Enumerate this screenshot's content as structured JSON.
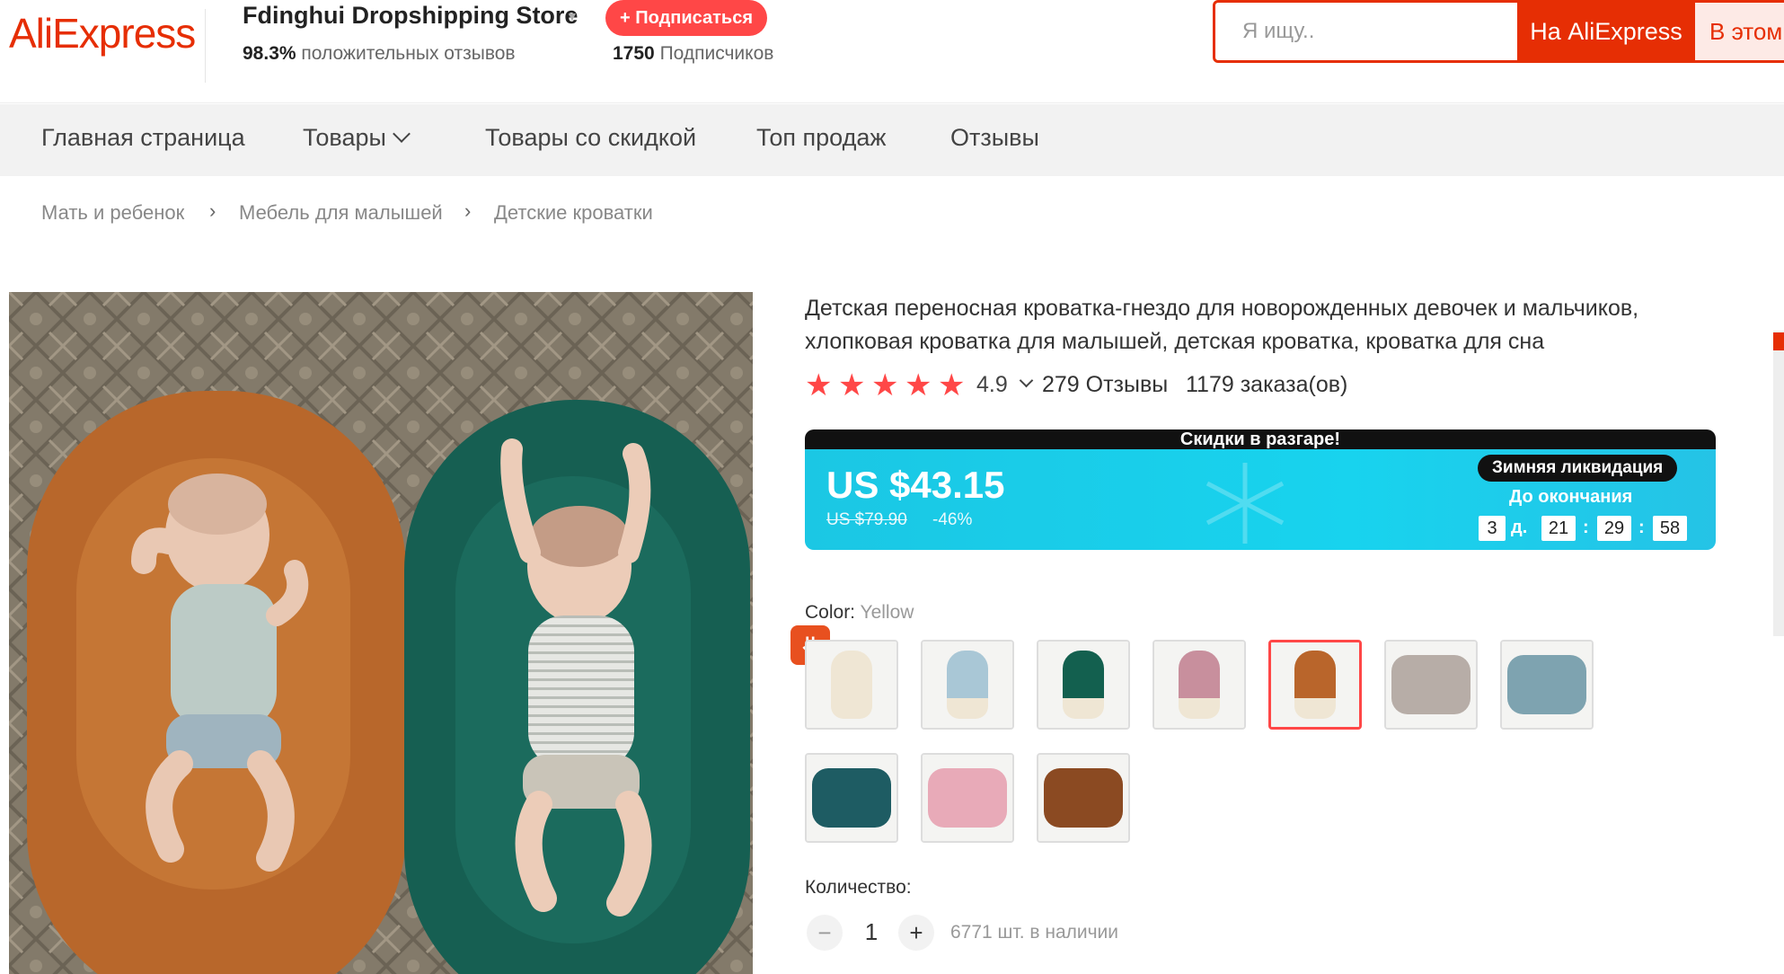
{
  "header": {
    "logo": "AliExpress",
    "store_name": "Fdinghui Dropshipping Store",
    "positive_value": "98.3%",
    "positive_text": "положительных отзывов",
    "subscribe_label": "+ Подписаться",
    "subscribers_value": "1750",
    "subscribers_text": "Подписчиков",
    "search_placeholder": "Я ищу..",
    "search_btn_aliexpress": "На AliExpress",
    "search_btn_store": "В этом"
  },
  "nav": {
    "items": [
      {
        "label": "Главная страница"
      },
      {
        "label": "Товары"
      },
      {
        "label": "Товары со скидкой"
      },
      {
        "label": "Топ продаж"
      },
      {
        "label": "Отзывы"
      }
    ]
  },
  "breadcrumb": [
    "Мать и ребенок",
    "Мебель для малышей",
    "Детские кроватки"
  ],
  "product": {
    "title": "Детская переносная кроватка-гнездо для новорожденных девочек и мальчиков, хлопковая кроватка для малышей, детская кроватка, кроватка для сна",
    "rating": "4.9",
    "stars": 5,
    "reviews": "279 Отзывы",
    "orders": "1179 заказа(ов)"
  },
  "promo": {
    "top_text": "Скидки в разгаре!",
    "price": "US $43.15",
    "old_price": "US $79.90",
    "discount": "-46%",
    "badge": "Зимняя ликвидация",
    "until": "До окончания",
    "countdown": {
      "days": "3",
      "days_unit": "д.",
      "hours": "21",
      "minutes": "29",
      "seconds": "58"
    }
  },
  "color": {
    "label": "Color:",
    "value": "Yellow",
    "swatches": [
      {
        "name": "cream",
        "color": "#efe6d4"
      },
      {
        "name": "light-blue",
        "color": "#a9c7d6"
      },
      {
        "name": "green",
        "color": "#13604f"
      },
      {
        "name": "pink",
        "color": "#c88f9d"
      },
      {
        "name": "yellow",
        "color": "#b9652b",
        "selected": true
      },
      {
        "name": "grey-texture",
        "color": "#b7ada7"
      },
      {
        "name": "blue-texture",
        "color": "#7ea3b0"
      },
      {
        "name": "teal-texture",
        "color": "#1e5c63"
      },
      {
        "name": "pink-texture",
        "color": "#e8aab8"
      },
      {
        "name": "brown-texture",
        "color": "#8b4a22"
      }
    ]
  },
  "quantity": {
    "label": "Количество:",
    "minus": "−",
    "value": "1",
    "plus": "+",
    "stock": "6771 шт. в наличии"
  }
}
